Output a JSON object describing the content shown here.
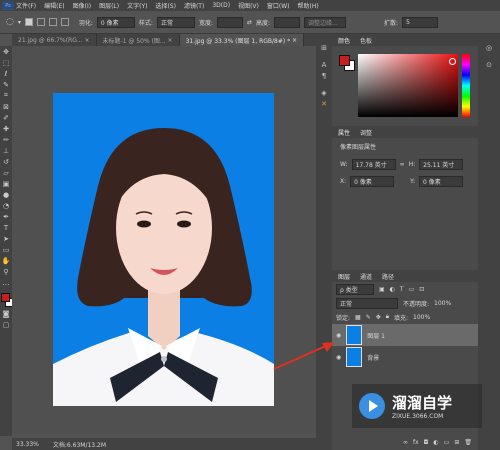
{
  "menu": [
    "文件(F)",
    "编辑(E)",
    "图像(I)",
    "图层(L)",
    "文字(Y)",
    "选择(S)",
    "滤镜(T)",
    "3D(D)",
    "视图(V)",
    "窗口(W)",
    "帮助(H)"
  ],
  "logo": "Ps",
  "options": {
    "feather_label": "羽化:",
    "feather_value": "0 像素",
    "style_label": "样式:",
    "style_value": "正常",
    "width_label": "宽度:",
    "height_label": "高度:",
    "refine_label": "调整边缘...",
    "expand_label": "扩散:",
    "expand_value": "5"
  },
  "tabs": [
    "21.jpg @ 66.7%(RG...",
    "未标题-1 @ 50% (图...",
    "31.jpg @ 33.3% (图层 1, RGB/8#) *"
  ],
  "status": {
    "zoom": "33.33%",
    "doc": "文档:6.63M/13.2M"
  },
  "color_panel": {
    "tabs": [
      "颜色",
      "色板"
    ],
    "fg": "#c81e1e",
    "bg": "#ffffff"
  },
  "props_panel": {
    "tabs": [
      "属性",
      "调整"
    ],
    "title": "像素图层属性",
    "w_label": "W:",
    "w_value": "17.78 英寸",
    "h_label": "H:",
    "h_value": "25.11 英寸",
    "x_label": "X:",
    "x_value": "0 像素",
    "y_label": "Y:",
    "y_value": "0 像素"
  },
  "layers_panel": {
    "tabs": [
      "图层",
      "通道",
      "路径"
    ],
    "filter": "ρ 类型",
    "blend": "正常",
    "opacity_label": "不透明度:",
    "opacity": "100%",
    "lock_label": "锁定:",
    "fill_label": "填充:",
    "fill": "100%",
    "layers": [
      {
        "name": "图层 1"
      },
      {
        "name": "背景"
      }
    ],
    "footer_icons": [
      "link",
      "fx",
      "mask",
      "adjust",
      "folder",
      "new",
      "trash"
    ]
  },
  "watermark": {
    "brand": "溜溜自学",
    "url": "ZIXUE.3066.COM"
  },
  "colors": {
    "photo_bg": "#0b7fe3",
    "annotation": "#e0311f"
  }
}
